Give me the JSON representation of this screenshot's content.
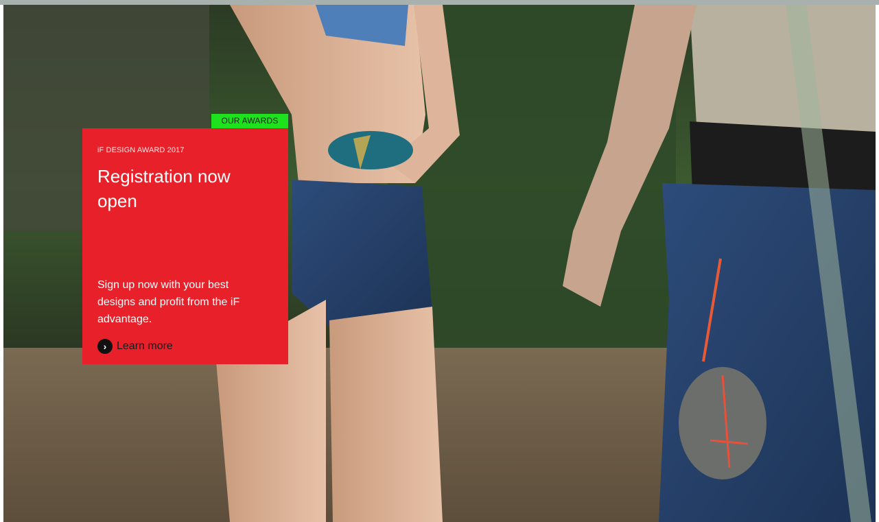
{
  "award_tag": "OUR AWARDS",
  "card": {
    "eyebrow": "iF DESIGN AWARD 2017",
    "headline": "Registration now open",
    "body": "Sign up now with your best designs and profit from the iF advantage.",
    "cta_label": "Learn more"
  },
  "colors": {
    "card_background": "#e8202a",
    "tag_background": "#1fe21f",
    "cta_icon_background": "#111111"
  },
  "icons": {
    "cta": "chevron-right-icon"
  }
}
